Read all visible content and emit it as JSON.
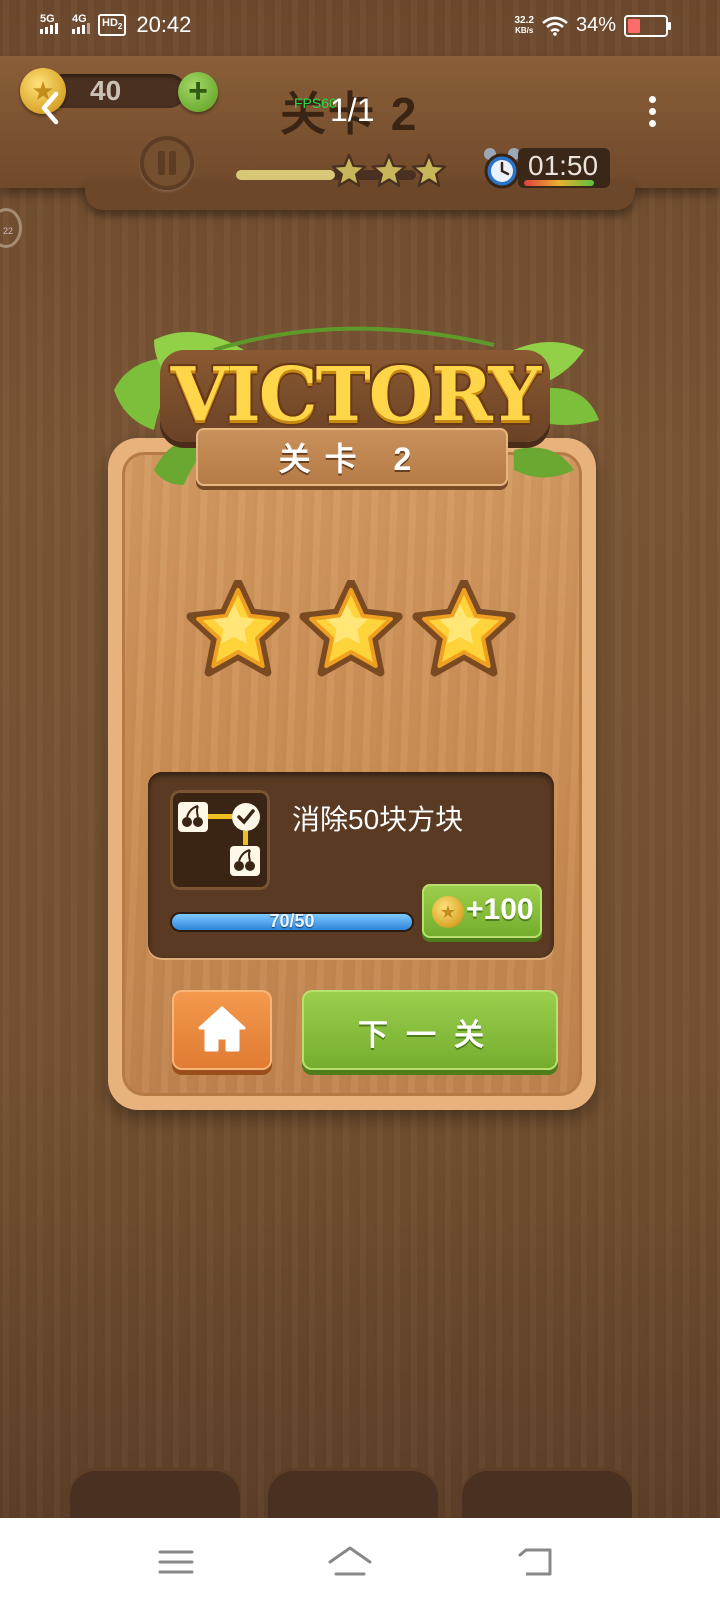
{
  "status_bar": {
    "network_1": "5G",
    "network_2": "4G",
    "hd_badge": "HD",
    "hd_sub": "2",
    "time": "20:42",
    "net_speed_value": "32.2",
    "net_speed_unit": "KB/s",
    "battery_percent": "34%",
    "battery_level": 0.34
  },
  "header": {
    "coins": "40",
    "plus_label": "+",
    "level_title": "关卡 2",
    "fps_label": "FPS60",
    "page_indicator": "1/1",
    "timer": "01:50",
    "progress_fraction": 0.55,
    "stars_earned": 3,
    "side_badge": "22"
  },
  "victory": {
    "title": "VICTORY",
    "subtitle": "关卡 2",
    "stars": 3
  },
  "task": {
    "description": "消除50块方块",
    "progress_text": "70/50",
    "progress_fraction": 1.0,
    "reward": "+100"
  },
  "buttons": {
    "next_level": "下一关"
  },
  "colors": {
    "wood": "#7a5535",
    "panel": "#c98c53",
    "next_green": "#8cc23f",
    "home_orange": "#f0883a",
    "progress_blue": "#2d86d9"
  }
}
